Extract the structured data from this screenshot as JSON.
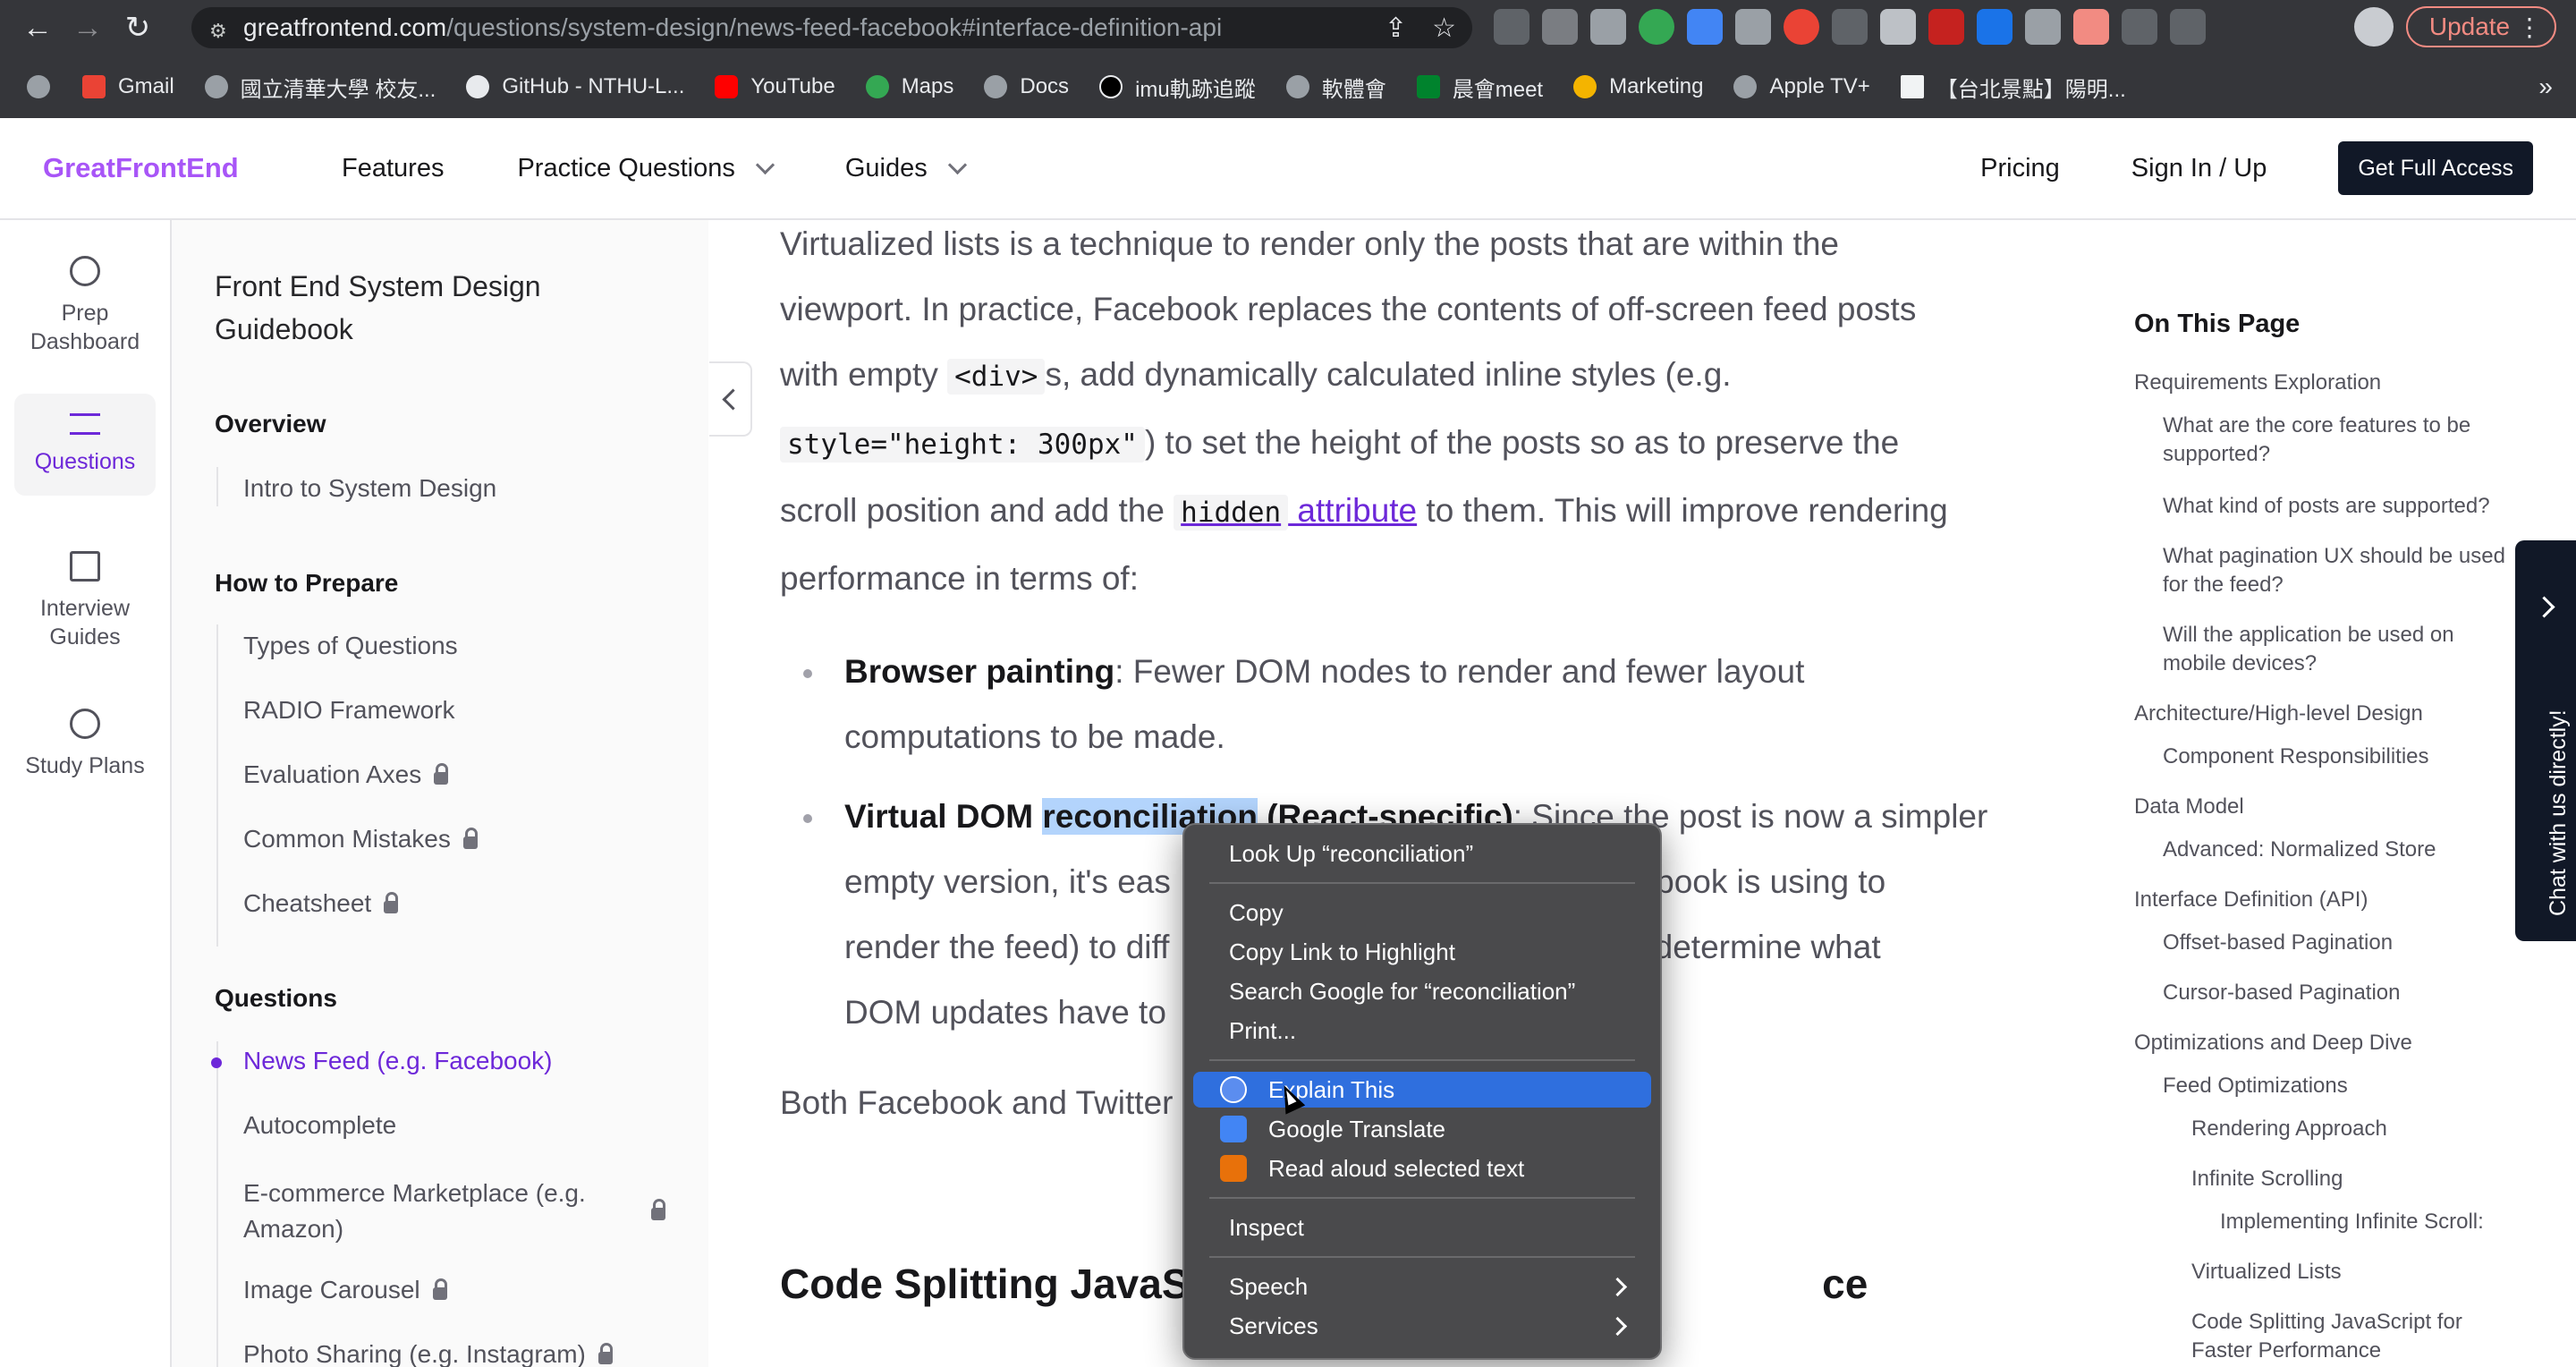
{
  "browser": {
    "url_host": "greatfrontend.com",
    "url_path": "/questions/system-design/news-feed-facebook#interface-definition-api",
    "update_label": "Update",
    "bookmarks": [
      "Gmail",
      "國立清華大學 校友...",
      "GitHub - NTHU-L...",
      "YouTube",
      "Maps",
      "Docs",
      "imu軌跡追蹤",
      "軟體會",
      "晨會meet",
      "Marketing",
      "Apple TV+",
      "【台北景點】陽明..."
    ],
    "bookmarks_more": "»"
  },
  "header": {
    "logo": "GreatFrontEnd",
    "nav": [
      "Features",
      "Practice Questions",
      "Guides"
    ],
    "pricing": "Pricing",
    "sign_in": "Sign In / Up",
    "cta": "Get Full Access"
  },
  "rail": {
    "items": [
      {
        "label": "Prep Dashboard",
        "icon": "user-circle-icon"
      },
      {
        "label": "Questions",
        "icon": "list-icon"
      },
      {
        "label": "Interview Guides",
        "icon": "book-icon"
      },
      {
        "label": "Study Plans",
        "icon": "clock-icon"
      }
    ]
  },
  "sidebar": {
    "title": "Front End System Design Guidebook",
    "overview_heading": "Overview",
    "overview_items": [
      "Intro to System Design"
    ],
    "prepare_heading": "How to Prepare",
    "prepare_items": [
      "Types of Questions",
      "RADIO Framework",
      "Evaluation Axes",
      "Common Mistakes",
      "Cheatsheet"
    ],
    "questions_heading": "Questions",
    "question_items": [
      "News Feed (e.g. Facebook)",
      "Autocomplete",
      "E-commerce Marketplace (e.g. Amazon)",
      "Image Carousel",
      "Photo Sharing (e.g. Instagram)"
    ]
  },
  "content": {
    "para1_a": "Virtualized lists is a technique to render only the posts that are within the",
    "para1_b": "viewport. In practice, Facebook replaces the contents of off-screen feed posts",
    "para1_c1": "with empty ",
    "para1_code1": "<div>",
    "para1_c2": "s, add dynamically calculated inline styles (e.g.",
    "para1_code2": "style=\"height: 300px\"",
    "para1_d": ") to set the height of the posts so as to preserve the",
    "para1_e1": "scroll position and add the ",
    "para1_code3": "hidden",
    "para1_link": " attribute",
    "para1_e2": " to them. This will improve rendering",
    "para1_f": "performance in terms of:",
    "b1_bold": "Browser painting",
    "b1_a": ": Fewer DOM nodes to render and fewer layout",
    "b1_b": "computations to be made.",
    "b2_bold_a": "Virtual DOM ",
    "b2_bold_hl": "reconciliation",
    "b2_bold_b": " (React-specific)",
    "b2_a": ": Since the post is now a simpler",
    "b2_b1": "empty version, it's eas",
    "b2_b2": "Facebook is using to",
    "b2_c1": "render the feed) to diff",
    "b2_c2": "M to determine what",
    "b2_d": "DOM updates have to",
    "para2": "Both Facebook and Twitter",
    "h2_a": "Code Splitting JavaSc",
    "h2_b": "ce"
  },
  "on_this_page": {
    "title": "On This Page",
    "items": [
      {
        "text": "Requirements Exploration",
        "level": 1
      },
      {
        "text": "What are the core features to be supported?",
        "level": 2
      },
      {
        "text": "What kind of posts are supported?",
        "level": 2
      },
      {
        "text": "What pagination UX should be used for the feed?",
        "level": 2
      },
      {
        "text": "Will the application be used on mobile devices?",
        "level": 2
      },
      {
        "text": "Architecture/High-level Design",
        "level": 1
      },
      {
        "text": "Component Responsibilities",
        "level": 2
      },
      {
        "text": "Data Model",
        "level": 1
      },
      {
        "text": "Advanced: Normalized Store",
        "level": 2
      },
      {
        "text": "Interface Definition (API)",
        "level": 1
      },
      {
        "text": "Offset-based Pagination",
        "level": 2
      },
      {
        "text": "Cursor-based Pagination",
        "level": 2
      },
      {
        "text": "Optimizations and Deep Dive",
        "level": 1
      },
      {
        "text": "Feed Optimizations",
        "level": 2
      },
      {
        "text": "Rendering Approach",
        "level": 3
      },
      {
        "text": "Infinite Scrolling",
        "level": 3
      },
      {
        "text": "Implementing Infinite Scroll:",
        "level": 4
      },
      {
        "text": "Virtualized Lists",
        "level": 3
      },
      {
        "text": "Code Splitting JavaScript for Faster Performance",
        "level": 3
      }
    ]
  },
  "chat": {
    "label": "Chat with us directly!"
  },
  "context_menu": {
    "look_up": "Look Up “reconciliation”",
    "copy": "Copy",
    "copy_link": "Copy Link to Highlight",
    "search_google": "Search Google for “reconciliation”",
    "print": "Print...",
    "explain": "Explain This",
    "translate": "Google Translate",
    "read_aloud": "Read aloud selected text",
    "inspect": "Inspect",
    "speech": "Speech",
    "services": "Services"
  }
}
